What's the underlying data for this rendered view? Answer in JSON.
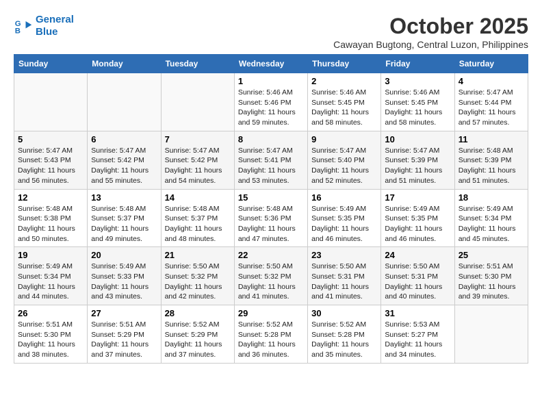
{
  "logo": {
    "line1": "General",
    "line2": "Blue"
  },
  "title": "October 2025",
  "subtitle": "Cawayan Bugtong, Central Luzon, Philippines",
  "days_of_week": [
    "Sunday",
    "Monday",
    "Tuesday",
    "Wednesday",
    "Thursday",
    "Friday",
    "Saturday"
  ],
  "weeks": [
    [
      {
        "day": "",
        "info": ""
      },
      {
        "day": "",
        "info": ""
      },
      {
        "day": "",
        "info": ""
      },
      {
        "day": "1",
        "info": "Sunrise: 5:46 AM\nSunset: 5:46 PM\nDaylight: 11 hours\nand 59 minutes."
      },
      {
        "day": "2",
        "info": "Sunrise: 5:46 AM\nSunset: 5:45 PM\nDaylight: 11 hours\nand 58 minutes."
      },
      {
        "day": "3",
        "info": "Sunrise: 5:46 AM\nSunset: 5:45 PM\nDaylight: 11 hours\nand 58 minutes."
      },
      {
        "day": "4",
        "info": "Sunrise: 5:47 AM\nSunset: 5:44 PM\nDaylight: 11 hours\nand 57 minutes."
      }
    ],
    [
      {
        "day": "5",
        "info": "Sunrise: 5:47 AM\nSunset: 5:43 PM\nDaylight: 11 hours\nand 56 minutes."
      },
      {
        "day": "6",
        "info": "Sunrise: 5:47 AM\nSunset: 5:42 PM\nDaylight: 11 hours\nand 55 minutes."
      },
      {
        "day": "7",
        "info": "Sunrise: 5:47 AM\nSunset: 5:42 PM\nDaylight: 11 hours\nand 54 minutes."
      },
      {
        "day": "8",
        "info": "Sunrise: 5:47 AM\nSunset: 5:41 PM\nDaylight: 11 hours\nand 53 minutes."
      },
      {
        "day": "9",
        "info": "Sunrise: 5:47 AM\nSunset: 5:40 PM\nDaylight: 11 hours\nand 52 minutes."
      },
      {
        "day": "10",
        "info": "Sunrise: 5:47 AM\nSunset: 5:39 PM\nDaylight: 11 hours\nand 51 minutes."
      },
      {
        "day": "11",
        "info": "Sunrise: 5:48 AM\nSunset: 5:39 PM\nDaylight: 11 hours\nand 51 minutes."
      }
    ],
    [
      {
        "day": "12",
        "info": "Sunrise: 5:48 AM\nSunset: 5:38 PM\nDaylight: 11 hours\nand 50 minutes."
      },
      {
        "day": "13",
        "info": "Sunrise: 5:48 AM\nSunset: 5:37 PM\nDaylight: 11 hours\nand 49 minutes."
      },
      {
        "day": "14",
        "info": "Sunrise: 5:48 AM\nSunset: 5:37 PM\nDaylight: 11 hours\nand 48 minutes."
      },
      {
        "day": "15",
        "info": "Sunrise: 5:48 AM\nSunset: 5:36 PM\nDaylight: 11 hours\nand 47 minutes."
      },
      {
        "day": "16",
        "info": "Sunrise: 5:49 AM\nSunset: 5:35 PM\nDaylight: 11 hours\nand 46 minutes."
      },
      {
        "day": "17",
        "info": "Sunrise: 5:49 AM\nSunset: 5:35 PM\nDaylight: 11 hours\nand 46 minutes."
      },
      {
        "day": "18",
        "info": "Sunrise: 5:49 AM\nSunset: 5:34 PM\nDaylight: 11 hours\nand 45 minutes."
      }
    ],
    [
      {
        "day": "19",
        "info": "Sunrise: 5:49 AM\nSunset: 5:34 PM\nDaylight: 11 hours\nand 44 minutes."
      },
      {
        "day": "20",
        "info": "Sunrise: 5:49 AM\nSunset: 5:33 PM\nDaylight: 11 hours\nand 43 minutes."
      },
      {
        "day": "21",
        "info": "Sunrise: 5:50 AM\nSunset: 5:32 PM\nDaylight: 11 hours\nand 42 minutes."
      },
      {
        "day": "22",
        "info": "Sunrise: 5:50 AM\nSunset: 5:32 PM\nDaylight: 11 hours\nand 41 minutes."
      },
      {
        "day": "23",
        "info": "Sunrise: 5:50 AM\nSunset: 5:31 PM\nDaylight: 11 hours\nand 41 minutes."
      },
      {
        "day": "24",
        "info": "Sunrise: 5:50 AM\nSunset: 5:31 PM\nDaylight: 11 hours\nand 40 minutes."
      },
      {
        "day": "25",
        "info": "Sunrise: 5:51 AM\nSunset: 5:30 PM\nDaylight: 11 hours\nand 39 minutes."
      }
    ],
    [
      {
        "day": "26",
        "info": "Sunrise: 5:51 AM\nSunset: 5:30 PM\nDaylight: 11 hours\nand 38 minutes."
      },
      {
        "day": "27",
        "info": "Sunrise: 5:51 AM\nSunset: 5:29 PM\nDaylight: 11 hours\nand 37 minutes."
      },
      {
        "day": "28",
        "info": "Sunrise: 5:52 AM\nSunset: 5:29 PM\nDaylight: 11 hours\nand 37 minutes."
      },
      {
        "day": "29",
        "info": "Sunrise: 5:52 AM\nSunset: 5:28 PM\nDaylight: 11 hours\nand 36 minutes."
      },
      {
        "day": "30",
        "info": "Sunrise: 5:52 AM\nSunset: 5:28 PM\nDaylight: 11 hours\nand 35 minutes."
      },
      {
        "day": "31",
        "info": "Sunrise: 5:53 AM\nSunset: 5:27 PM\nDaylight: 11 hours\nand 34 minutes."
      },
      {
        "day": "",
        "info": ""
      }
    ]
  ]
}
